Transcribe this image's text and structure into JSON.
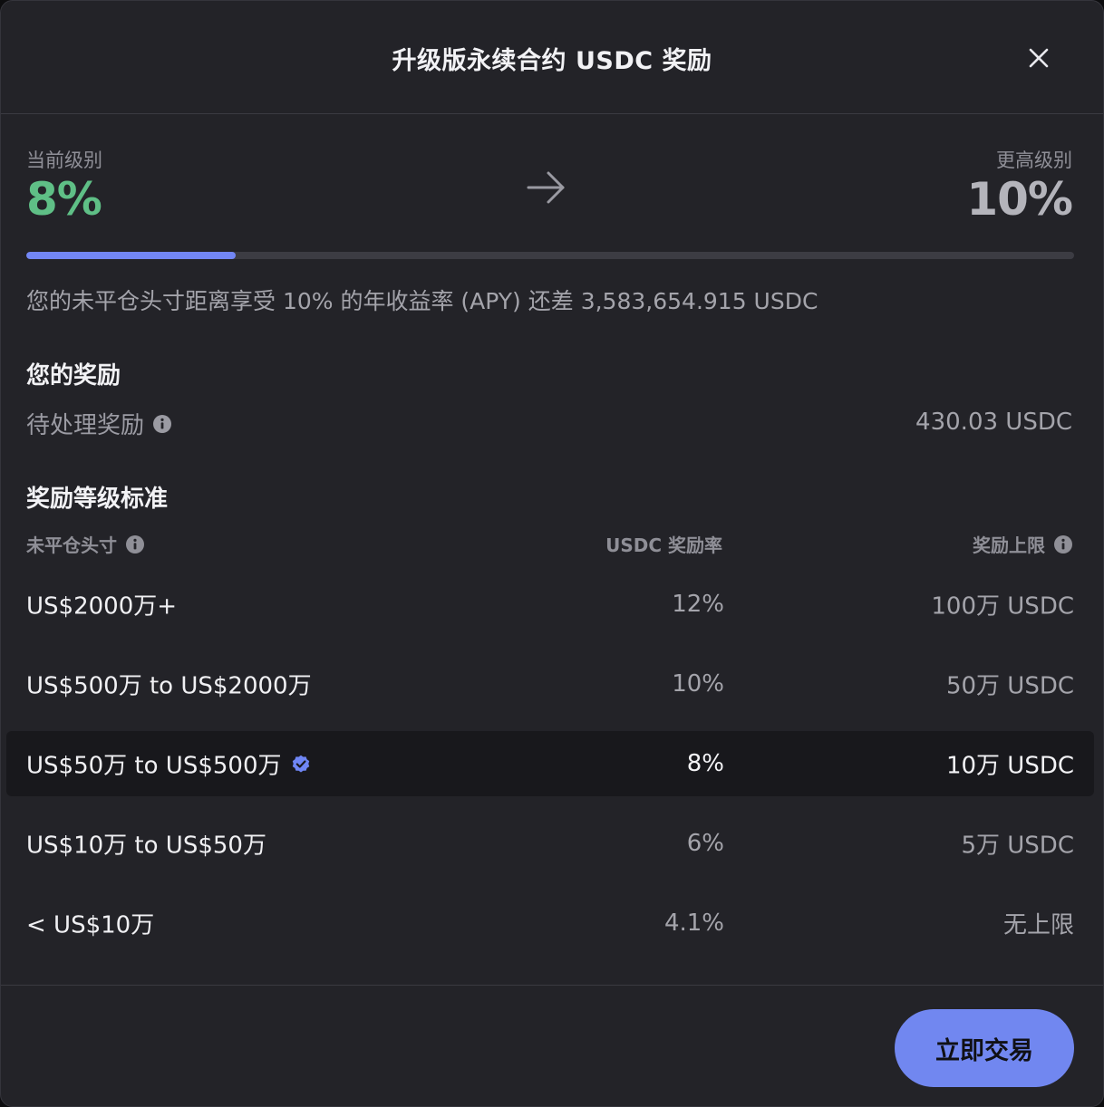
{
  "modal": {
    "title": "升级版永续合约 USDC 奖励"
  },
  "tier": {
    "current_label": "当前级别",
    "current_value": "8%",
    "next_label": "更高级别",
    "next_value": "10%",
    "progress_fraction": 0.2
  },
  "progress_note": "您的未平仓头寸距离享受 10% 的年收益率 (APY) 还差 3,583,654.915 USDC",
  "rewards": {
    "section_title": "您的奖励",
    "pending_label": "待处理奖励",
    "pending_value": "430.03 USDC"
  },
  "standards": {
    "section_title": "奖励等级标准",
    "headers": {
      "position": "未平仓头寸",
      "rate": "USDC 奖励率",
      "cap": "奖励上限"
    },
    "rows": [
      {
        "range": "US$2000万+",
        "rate": "12%",
        "cap": "100万 USDC"
      },
      {
        "range": "US$500万 to US$2000万",
        "rate": "10%",
        "cap": "50万 USDC"
      },
      {
        "range": "US$50万 to US$500万",
        "rate": "8%",
        "cap": "10万 USDC"
      },
      {
        "range": "US$10万 to US$50万",
        "rate": "6%",
        "cap": "5万 USDC"
      },
      {
        "range": "< US$10万",
        "rate": "4.1%",
        "cap": "无上限"
      }
    ]
  },
  "footer": {
    "trade_button": "立即交易"
  },
  "colors": {
    "accent": "#7187f0",
    "current_tier": "#5fbf86",
    "background": "#232328"
  },
  "icons": {
    "close": "close-icon",
    "arrow": "arrow-right-icon",
    "info": "info-icon",
    "active_tier": "check-badge-icon"
  }
}
